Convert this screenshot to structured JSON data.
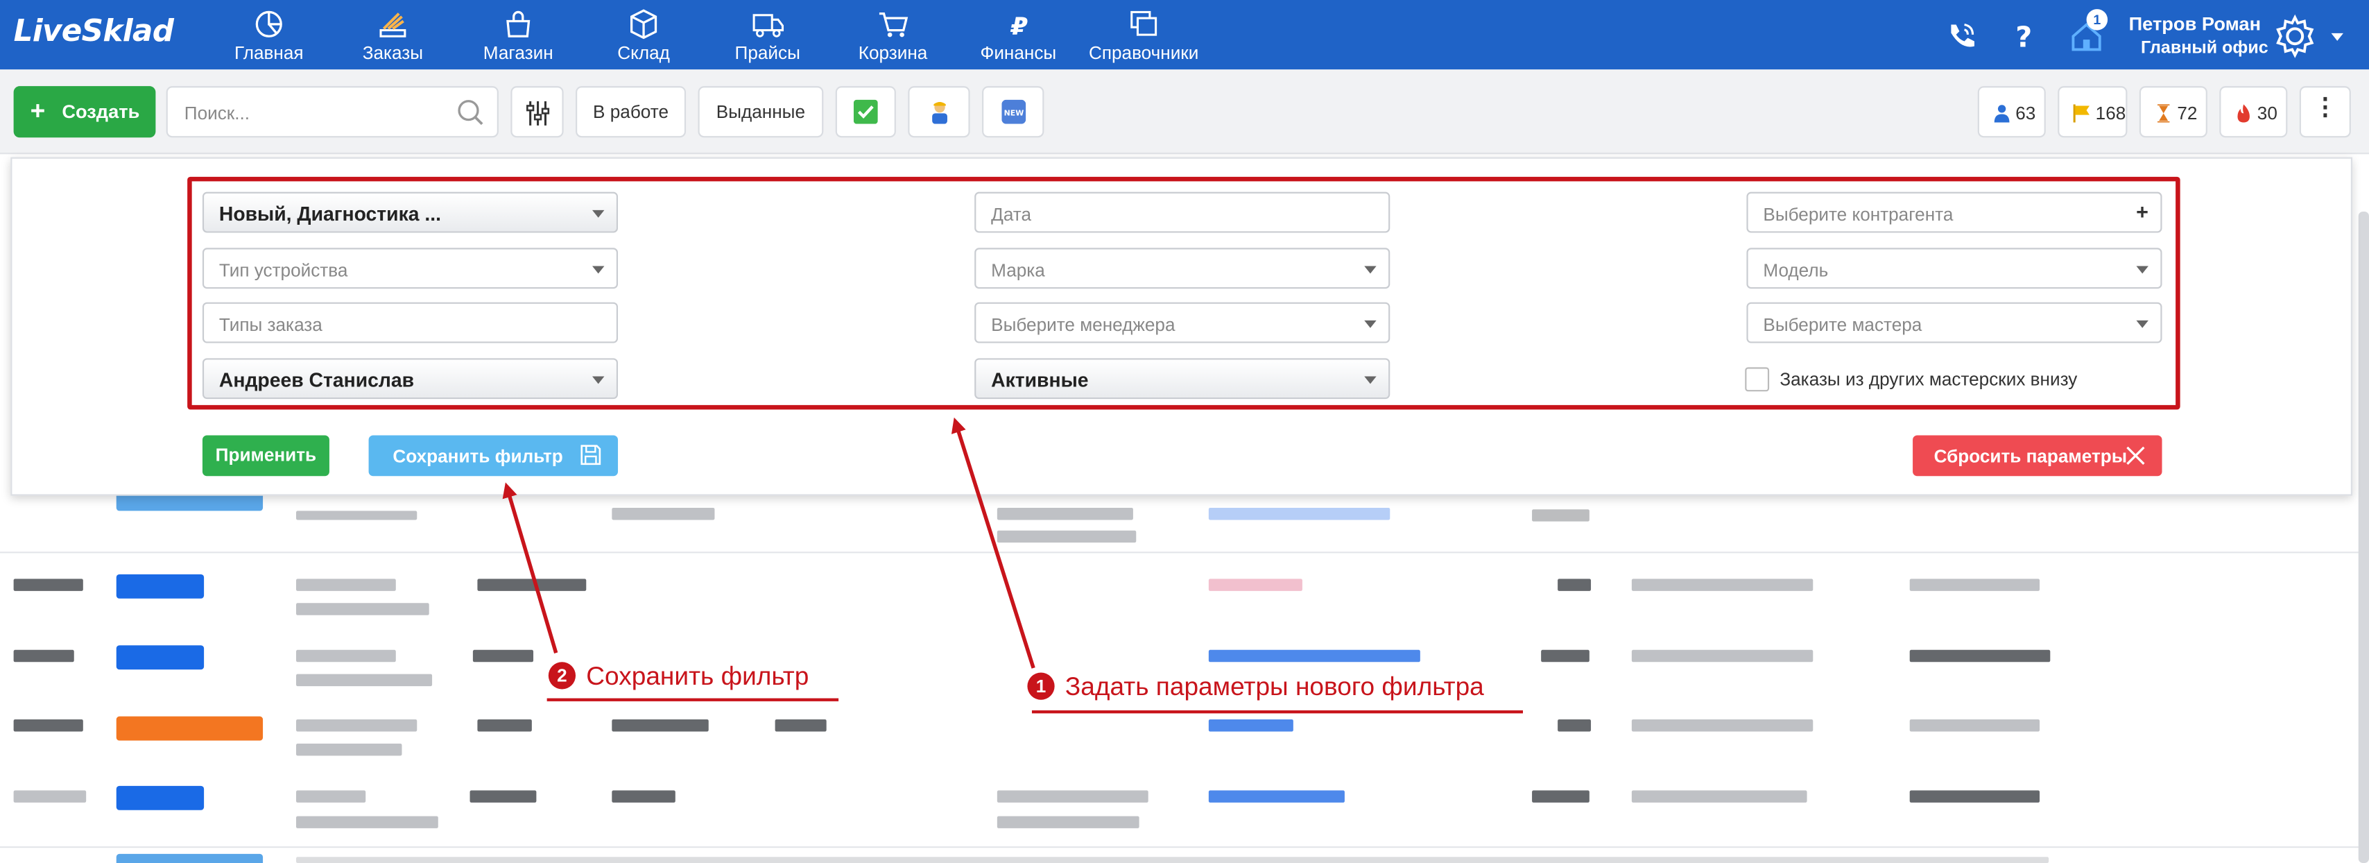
{
  "app": {
    "logo": "LiveSklad"
  },
  "nav": {
    "items": [
      {
        "label": "Главная",
        "icon": "pie-chart-icon"
      },
      {
        "label": "Заказы",
        "icon": "orders-icon"
      },
      {
        "label": "Магазин",
        "icon": "shop-bag-icon"
      },
      {
        "label": "Склад",
        "icon": "box-icon"
      },
      {
        "label": "Прайсы",
        "icon": "truck-icon"
      },
      {
        "label": "Корзина",
        "icon": "cart-icon"
      },
      {
        "label": "Финансы",
        "icon": "ruble-icon"
      },
      {
        "label": "Справочники",
        "icon": "windows-icon"
      }
    ],
    "active": "Заказы",
    "notification_count": "1",
    "user": {
      "name": "Петров Роман",
      "office": "Главный офис"
    }
  },
  "toolbar": {
    "create_label": "Создать",
    "search_placeholder": "Поиск...",
    "in_work_label": "В работе",
    "issued_label": "Выданные",
    "counters": [
      {
        "icon": "person-icon",
        "value": "63",
        "color": "#2b6fd6"
      },
      {
        "icon": "flag-icon",
        "value": "168",
        "color": "#f2b800"
      },
      {
        "icon": "hourglass-icon",
        "value": "72",
        "color": "#e07a1f"
      },
      {
        "icon": "fire-icon",
        "value": "30",
        "color": "#e23b2e"
      }
    ]
  },
  "filter": {
    "status": "Новый, Диагностика ...",
    "date_placeholder": "Дата",
    "counterparty_placeholder": "Выберите контрагента",
    "device_type_placeholder": "Тип устройства",
    "brand_placeholder": "Марка",
    "model_placeholder": "Модель",
    "order_types_placeholder": "Типы заказа",
    "manager_placeholder": "Выберите менеджера",
    "master_placeholder": "Выберите мастера",
    "employee": "Андреев Станислав",
    "activity": "Активные",
    "other_workshops_label": "Заказы из других мастерских внизу",
    "apply_label": "Применить",
    "save_label": "Сохранить фильтр",
    "reset_label": "Сбросить параметры"
  },
  "annotations": {
    "step1_number": "1",
    "step1_text": "Задать параметры нового фильтра",
    "step2_number": "2",
    "step2_text": "Сохранить фильтр",
    "color": "#c8141b"
  }
}
